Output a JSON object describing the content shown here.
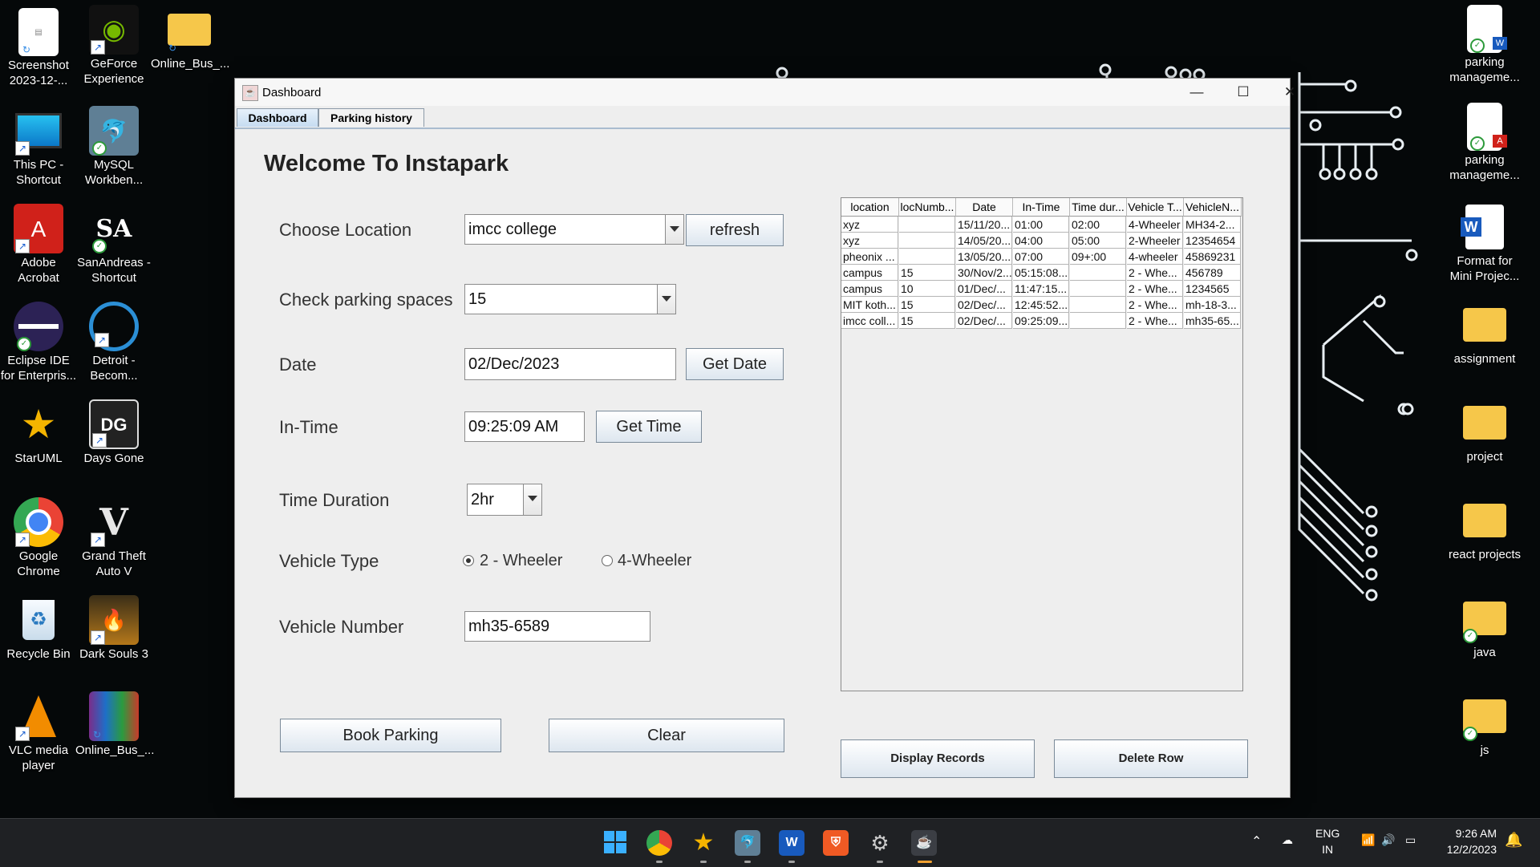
{
  "desktop": {
    "left_icons": [
      {
        "label": "Screenshot 2023-12-...",
        "icon": "screenshot-file-icon"
      },
      {
        "label": "GeForce Experience",
        "icon": "nvidia-icon"
      },
      {
        "label": "Online_Bus_...",
        "icon": "folder-icon"
      },
      {
        "label": "This PC - Shortcut",
        "icon": "monitor-icon"
      },
      {
        "label": "MySQL Workben...",
        "icon": "mysql-dolphin-icon"
      },
      {
        "label": "Adobe Acrobat",
        "icon": "acrobat-icon"
      },
      {
        "label": "SanAndreas - Shortcut",
        "icon": "sa-icon"
      },
      {
        "label": "Eclipse IDE for Enterpris...",
        "icon": "eclipse-icon"
      },
      {
        "label": "Detroit - Becom...",
        "icon": "detroit-icon"
      },
      {
        "label": "StarUML",
        "icon": "star-icon"
      },
      {
        "label": "Days Gone",
        "icon": "daysgone-icon"
      },
      {
        "label": "Google Chrome",
        "icon": "chrome-icon"
      },
      {
        "label": "Grand Theft Auto V",
        "icon": "gta-icon"
      },
      {
        "label": "Recycle Bin",
        "icon": "recycle-bin-icon"
      },
      {
        "label": "Dark Souls 3",
        "icon": "darksouls-icon"
      },
      {
        "label": "VLC media player",
        "icon": "vlc-cone-icon"
      },
      {
        "label": "Online_Bus_...",
        "icon": "winrar-icon"
      }
    ],
    "right_icons": [
      {
        "label": "parking manageme...",
        "icon": "word-doc-icon"
      },
      {
        "label": "parking manageme...",
        "icon": "pdf-doc-icon"
      },
      {
        "label": "Format for Mini Projec...",
        "icon": "word-icon"
      },
      {
        "label": "assignment",
        "icon": "folder-icon"
      },
      {
        "label": "project",
        "icon": "folder-icon"
      },
      {
        "label": "react projects",
        "icon": "folder-icon"
      },
      {
        "label": "java",
        "icon": "folder-icon"
      },
      {
        "label": "js",
        "icon": "folder-icon"
      }
    ]
  },
  "window": {
    "title": "Dashboard",
    "minimize": "—",
    "maximize": "☐",
    "close": "✕",
    "tabs": [
      "Dashboard",
      "Parking history"
    ],
    "active_tab": "Dashboard"
  },
  "form": {
    "heading": "Welcome To Instapark",
    "location_label": "Choose Location",
    "location_value": "imcc college",
    "refresh_button": "refresh",
    "spaces_label": "Check parking spaces",
    "spaces_value": "15",
    "date_label": "Date",
    "date_value": "02/Dec/2023",
    "get_date_button": "Get Date",
    "intime_label": "In-Time",
    "intime_value": "09:25:09 AM",
    "get_time_button": "Get Time",
    "duration_label": "Time Duration",
    "duration_value": "2hr",
    "vehicle_type_label": "Vehicle Type",
    "vehicle_type_options": [
      "2 - Wheeler",
      "4-Wheeler"
    ],
    "vehicle_type_selected": "2 - Wheeler",
    "vehicle_number_label": "Vehicle Number",
    "vehicle_number_value": "mh35-6589",
    "book_button": "Book Parking",
    "clear_button": "Clear"
  },
  "records": {
    "columns": [
      "location",
      "locNumb...",
      "Date",
      "In-Time",
      "Time dur...",
      "Vehicle T...",
      "VehicleN..."
    ],
    "rows": [
      [
        "xyz",
        "",
        "15/11/20...",
        "01:00",
        "02:00",
        "4-Wheeler",
        "MH34-2..."
      ],
      [
        "xyz",
        "",
        "14/05/20...",
        "04:00",
        "05:00",
        "2-Wheeler",
        "12354654"
      ],
      [
        "pheonix ...",
        "",
        "13/05/20...",
        "07:00",
        "09+:00",
        "4-wheeler",
        "45869231"
      ],
      [
        "campus",
        "15",
        "30/Nov/2...",
        "05:15:08...",
        "",
        "2 - Whe...",
        "456789"
      ],
      [
        "campus",
        "10",
        "01/Dec/...",
        "11:47:15...",
        "",
        "2 - Whe...",
        "1234565"
      ],
      [
        "MIT koth...",
        "15",
        "02/Dec/...",
        "12:45:52...",
        "",
        "2 - Whe...",
        "mh-18-3..."
      ],
      [
        "imcc coll...",
        "15",
        "02/Dec/...",
        "09:25:09...",
        "",
        "2 - Whe...",
        "mh35-65..."
      ]
    ],
    "display_button": "Display Records",
    "delete_button": "Delete Row"
  },
  "taskbar": {
    "apps": [
      "windows-start-icon",
      "chrome-icon",
      "staruml-icon",
      "mysql-icon",
      "word-icon",
      "brave-icon",
      "settings-gear-icon",
      "java-app-icon"
    ],
    "language": "ENG",
    "region": "IN",
    "time": "9:26 AM",
    "date": "12/2/2023"
  }
}
